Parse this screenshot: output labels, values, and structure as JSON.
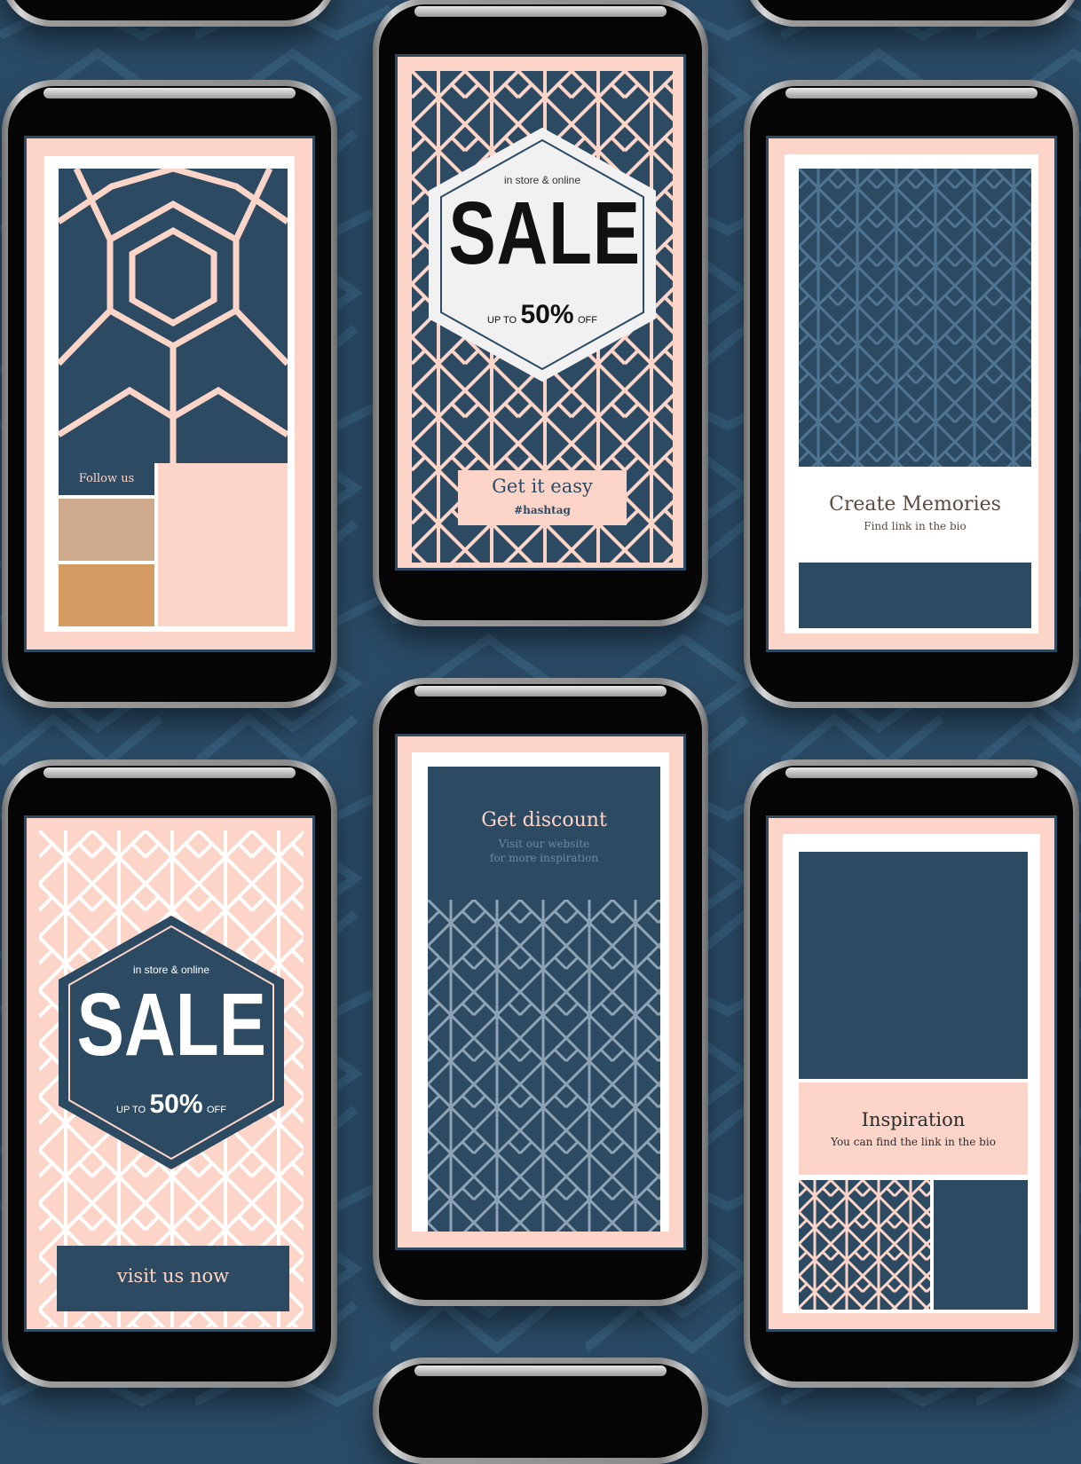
{
  "colors": {
    "navy": "#2c4a62",
    "peach": "#fdd5c8",
    "white": "#ffffff",
    "tan": "#cfa98b",
    "caramel": "#d49b63",
    "bg": "#2a4b66"
  },
  "story1": {
    "follow": "Follow us"
  },
  "story2": {
    "tagline": "in store & online",
    "sale": "SALE",
    "up_to": "UP TO",
    "percent": "50%",
    "off": "OFF",
    "cta": "Get it easy",
    "hashtag": "#hashtag"
  },
  "story3": {
    "title": "Create Memories",
    "subtitle": "Find link in the bio"
  },
  "story4": {
    "tagline": "in store & online",
    "sale": "SALE",
    "up_to": "UP TO",
    "percent": "50%",
    "off": "OFF",
    "cta": "visit us now"
  },
  "story5": {
    "title": "Get discount",
    "line1": "Visit our website",
    "line2": "for more inspiration"
  },
  "story6": {
    "title": "Inspiration",
    "subtitle": "You can find the link in the bio"
  }
}
